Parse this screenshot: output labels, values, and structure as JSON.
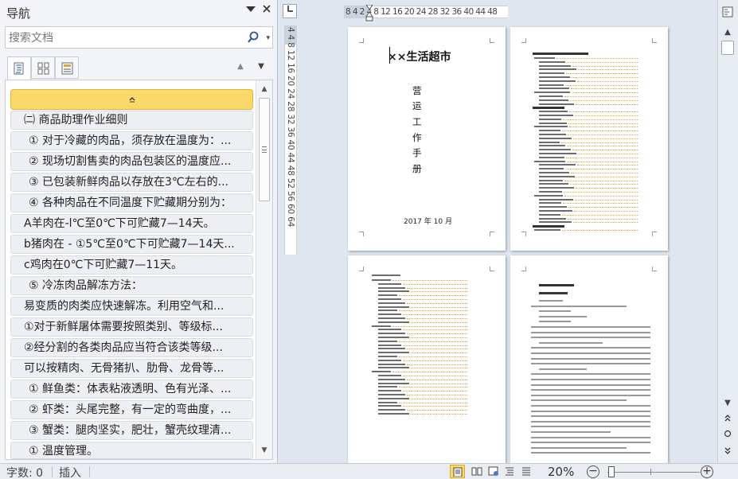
{
  "nav": {
    "title": "导航",
    "search_placeholder": "搜索文档",
    "items": [
      "㈡ 商品助理作业细则",
      "① 对于冷藏的肉品，须存放在温度为：...",
      "② 现场切割售卖的肉品包装区的温度应...",
      "③ 已包装新鲜肉品以存放在3℃左右的...",
      "④ 各种肉品在不同温度下贮藏期分别为：",
      "A羊肉在-l℃至0℃下可贮藏7—14天。",
      "b猪肉在 - ①5℃至0℃下可贮藏7—14天...",
      "c鸡肉在0℃下可贮藏7—11天。",
      "⑤ 冷冻肉品解冻方法：",
      "易变质的肉类应快速解冻。利用空气和...",
      "①对于新鲜屠体需要按照类别、等级标...",
      "②经分割的各类肉品应当符合该类等级...",
      "可以按精肉、无骨猪扒、肋骨、龙骨等...",
      "① 鲜鱼类：体表粘液透明、色有光泽、...",
      "② 虾类：头尾完整，有一定的弯曲度，...",
      "③ 蟹类：腿肉坚实，肥壮，蟹壳纹理清...",
      "① 温度管理。"
    ]
  },
  "ruler": {
    "horizontal": "8  4  2  4  8 12 16 20 24 28 32 36 40 44 48",
    "vertical": "4  4  8 12 16 20 24 28 32 36 40 44 48 52 56 60 64"
  },
  "doc": {
    "cover_title": "××生活超市",
    "vertical_title": [
      "营",
      "运",
      "工",
      "作",
      "手",
      "册"
    ],
    "cover_date": "2017 年 10 月"
  },
  "status": {
    "word_count": "字数: 0",
    "insert_mode": "插入",
    "zoom": "20%"
  },
  "colors": {
    "accent": "#fbd86a",
    "pane": "#f2f4f7",
    "workspace": "#dfe6ef"
  }
}
